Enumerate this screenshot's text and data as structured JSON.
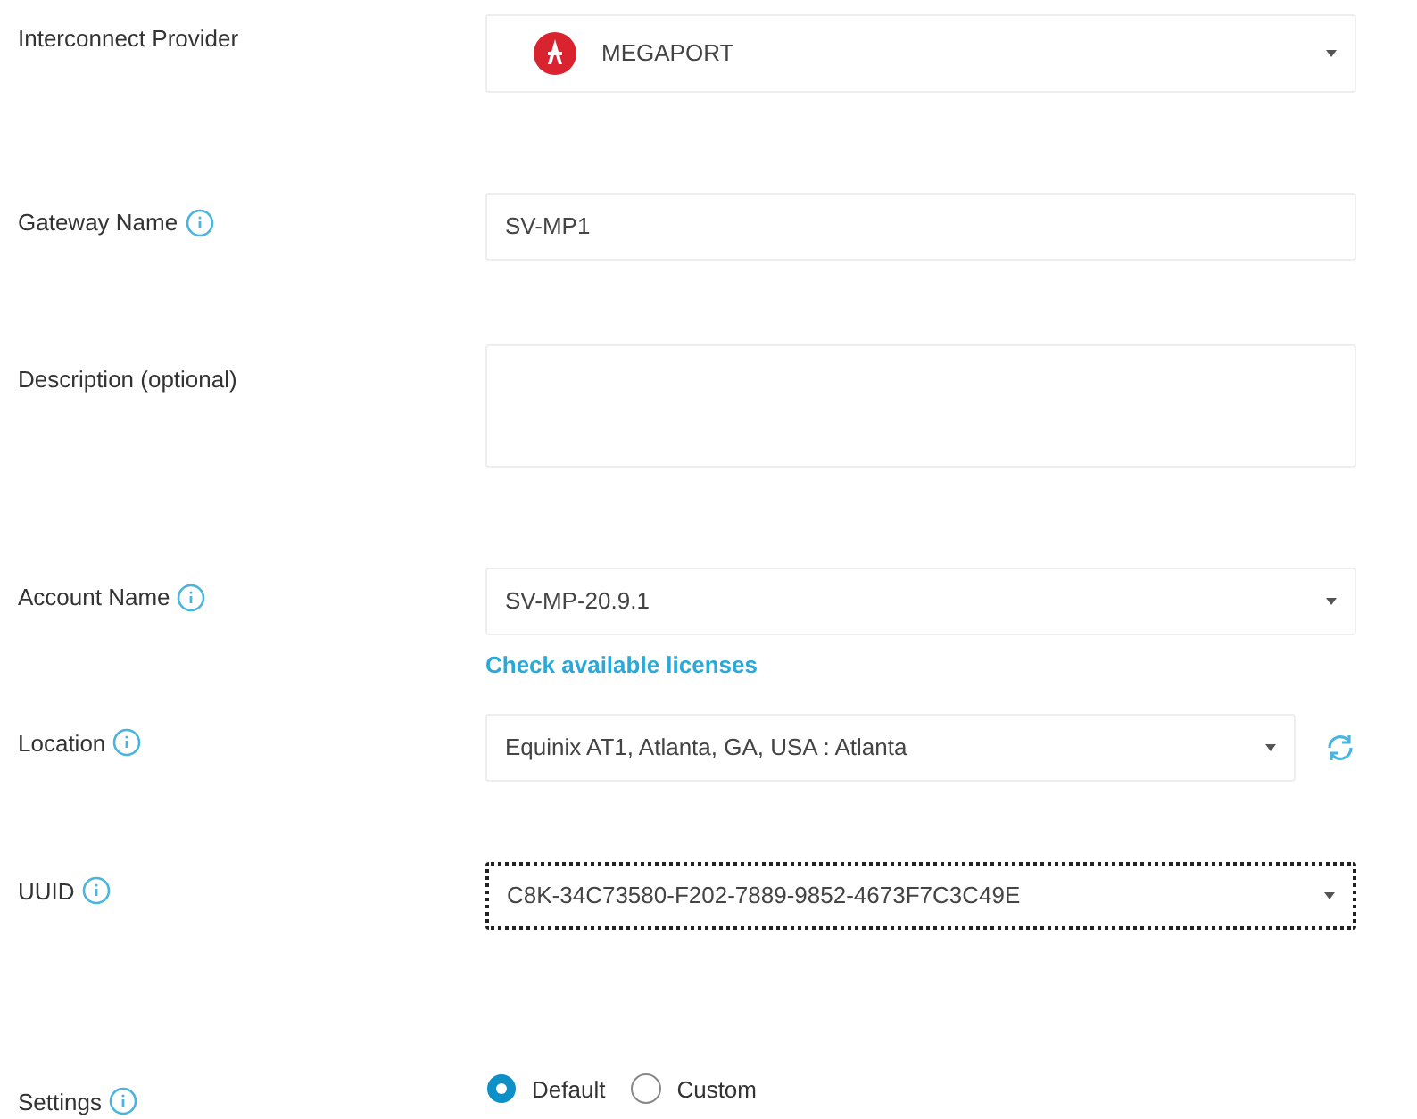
{
  "fields": [
    {
      "label": "Interconnect Provider",
      "info": false,
      "kind": "select",
      "value": "MEGAPORT",
      "logo": true
    },
    {
      "label": "Gateway Name",
      "info": true,
      "kind": "text",
      "value": "SV-MP1"
    },
    {
      "label": "Description (optional)",
      "info": false,
      "kind": "textarea"
    },
    {
      "label": "Account Name",
      "info": true,
      "kind": "select",
      "value": "SV-MP-20.9.1",
      "link": "Check available licenses"
    },
    {
      "label": "Location",
      "info": true,
      "kind": "select",
      "value": "Equinix AT1, Atlanta, GA, USA : Atlanta",
      "refresh": true
    },
    {
      "label": "UUID",
      "info": true,
      "kind": "select",
      "value": "C8K-34C73580-F202-7889-9852-4673F7C3C49E",
      "focused": true
    },
    {
      "label": "Settings",
      "info": true,
      "kind": "radio",
      "options": [
        {
          "label": "Default",
          "selected": true
        },
        {
          "label": "Custom",
          "selected": false
        }
      ]
    }
  ]
}
